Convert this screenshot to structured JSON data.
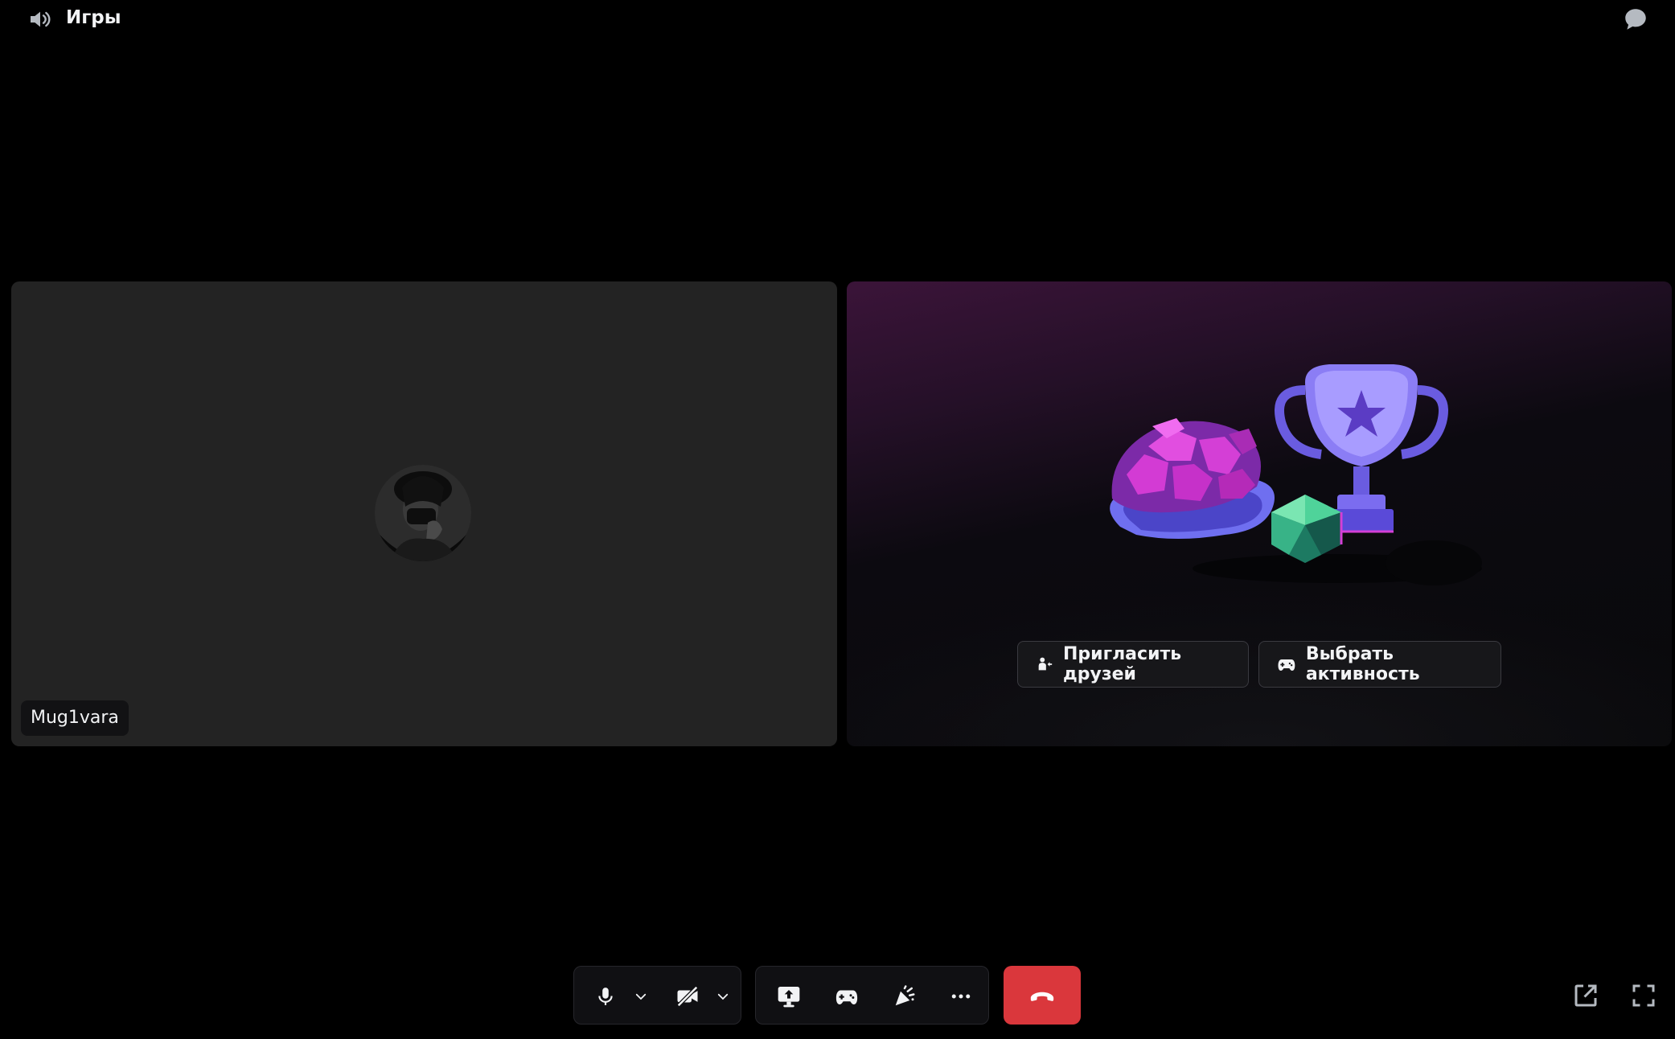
{
  "header": {
    "channel_icon": "speaker-icon",
    "channel_name": "Игры",
    "chat_icon": "chat-bubble-icon"
  },
  "participant": {
    "name": "Mug1vara",
    "tile_color": "#232323"
  },
  "activity_panel": {
    "illustration": "gem-shell-trophy-dice-illustration",
    "invite_icon": "invite-friends-icon",
    "invite_label": "Пригласить друзей",
    "activity_icon": "gamepad-icon",
    "activity_label": "Выбрать активность"
  },
  "controls": {
    "mic_icon": "microphone-icon",
    "mic_options_icon": "chevron-down-icon",
    "camera_icon": "camera-off-icon",
    "camera_options_icon": "chevron-down-icon",
    "screen_share_icon": "screen-share-icon",
    "activity_icon": "gamepad-icon",
    "soundboard_icon": "soundboard-icon",
    "more_icon": "more-icon",
    "hangup_icon": "hangup-icon",
    "hangup_color": "#da373c",
    "popout_icon": "popout-icon",
    "fullscreen_icon": "fullscreen-icon"
  }
}
